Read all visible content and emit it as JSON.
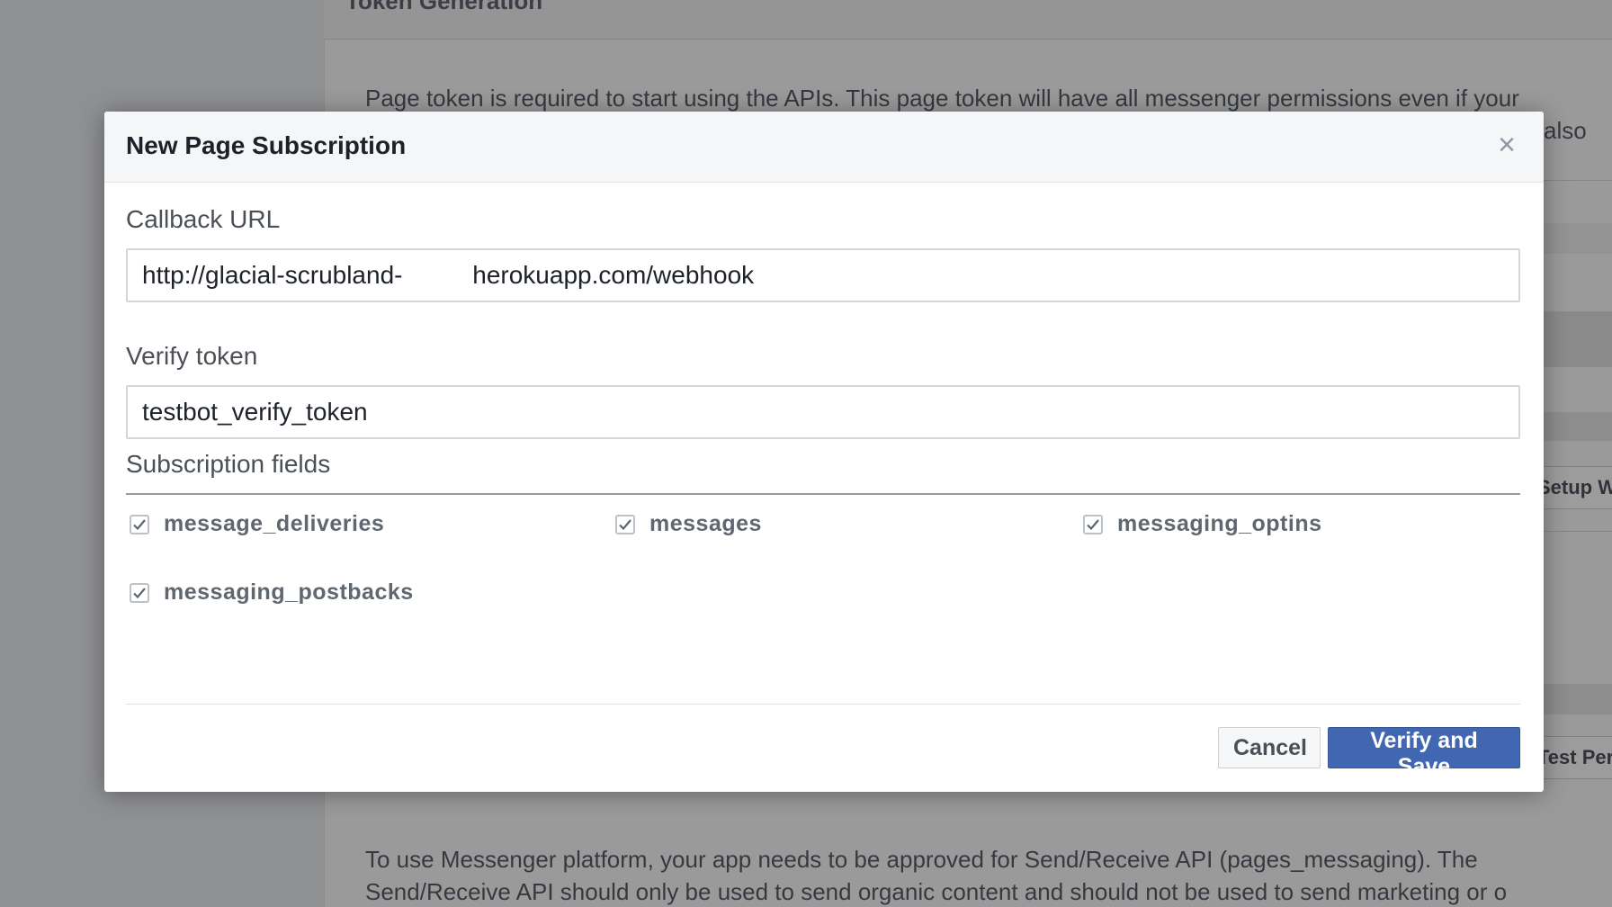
{
  "background": {
    "section_title": "Token Generation",
    "paragraph_1_line_1": "Page token is required to start using the APIs. This page token will have all messenger permissions even if your",
    "paragraph_1_line_2": "also",
    "button_1": "Setup W",
    "button_2": "Test Perm",
    "paragraph_2_line_1": "To use Messenger platform, your app needs to be approved for Send/Receive API (pages_messaging). The",
    "paragraph_2_line_2": "Send/Receive API should only be used to send organic content and should not be used to send marketing or o"
  },
  "modal": {
    "title": "New Page Subscription",
    "close_icon": "close-icon",
    "callback_url": {
      "label": "Callback URL",
      "value": "http://glacial-scrubland-          herokuapp.com/webhook"
    },
    "verify_token": {
      "label": "Verify token",
      "value": "testbot_verify_token"
    },
    "subscription_fields": {
      "label": "Subscription fields",
      "items": [
        {
          "label": "message_deliveries",
          "checked": true
        },
        {
          "label": "messages",
          "checked": true
        },
        {
          "label": "messaging_optins",
          "checked": true
        },
        {
          "label": "messaging_postbacks",
          "checked": true
        }
      ]
    },
    "buttons": {
      "cancel": "Cancel",
      "verify": "Verify and Save"
    }
  }
}
